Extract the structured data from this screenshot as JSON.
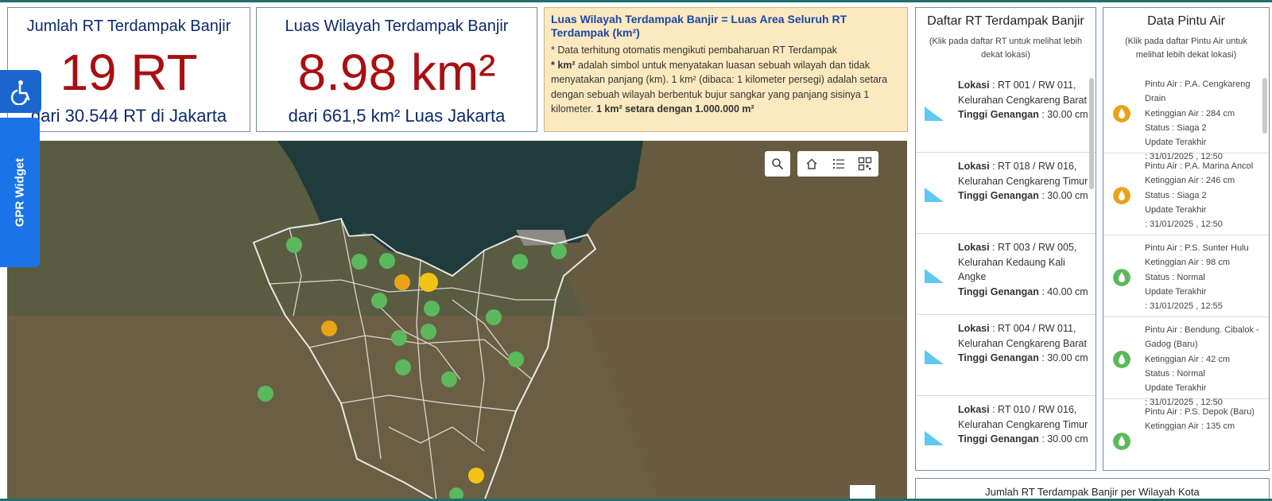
{
  "stat_rt": {
    "title": "Jumlah RT Terdampak Banjir",
    "value": "19 RT",
    "subtitle": "dari 30.544 RT di Jakarta"
  },
  "stat_luas": {
    "title": "Luas Wilayah Terdampak Banjir",
    "value": "8.98 km²",
    "subtitle": "dari 661,5 km² Luas Jakarta"
  },
  "info": {
    "title": "Luas Wilayah Terdampak Banjir = Luas Area Seluruh RT Terdampak (km²)",
    "line1": "* Data terhitung otomatis mengikuti pembaharuan RT Terdampak",
    "line2_bold": "* km²",
    "line2_rest": " adalah simbol untuk menyatakan luasan sebuah wilayah dan tidak menyatakan panjang (km). 1 km² (dibaca: 1 kilometer persegi) adalah setara dengan sebuah wilayah berbentuk bujur sangkar yang panjang sisinya 1 kilometer. ",
    "line2_tail_bold": "1 km² setara dengan 1.000.000 m²"
  },
  "rt_panel": {
    "title": "Daftar RT Terdampak Banjir",
    "note": "(Klik pada daftar RT untuk melihat lebih dekat lokasi)",
    "lokasi_label": "Lokasi",
    "tinggi_label": "Tinggi Genangan",
    "items": [
      {
        "lokasi": "RT 001 / RW 011, Kelurahan Cengkareng Barat",
        "tinggi": "30.00 cm"
      },
      {
        "lokasi": "RT 018 / RW 016, Kelurahan Cengkareng Timur",
        "tinggi": "30.00 cm"
      },
      {
        "lokasi": "RT 003 / RW 005, Kelurahan Kedaung Kali Angke",
        "tinggi": "40.00 cm"
      },
      {
        "lokasi": "RT 004 / RW 011, Kelurahan Cengkareng Barat",
        "tinggi": "30.00 cm"
      },
      {
        "lokasi": "RT 010 / RW 016, Kelurahan Cengkareng Timur",
        "tinggi": "30.00 cm"
      }
    ]
  },
  "pa_panel": {
    "title": "Data Pintu Air",
    "note": "(Klik pada daftar Pintu Air untuk melihat lebih dekat lokasi)",
    "items": [
      {
        "nama": "Pintu Air : P.A. Cengkareng Drain",
        "tinggi": "Ketinggian Air : 284 cm",
        "status": "Status : Siaga 2",
        "update": "Update Terakhir",
        "waktu": ": 31/01/2025 , 12:50",
        "color": "#e8a317"
      },
      {
        "nama": "Pintu Air : P.A. Marina Ancol",
        "tinggi": "Ketinggian Air : 246 cm",
        "status": "Status : Siaga 2",
        "update": "Update Terakhir",
        "waktu": ": 31/01/2025 , 12:50",
        "color": "#e8a317"
      },
      {
        "nama": "Pintu Air : P.S. Sunter Hulu",
        "tinggi": "Ketinggian Air : 98 cm",
        "status": "Status : Normal",
        "update": "Update Terakhir",
        "waktu": ": 31/01/2025 , 12:55",
        "color": "#5cb85c"
      },
      {
        "nama": "Pintu Air : Bendung. Cibalok - Gadog (Baru)",
        "tinggi": "Ketinggian Air : 42 cm",
        "status": "Status : Normal",
        "update": "Update Terakhir",
        "waktu": ": 31/01/2025 , 12:50",
        "color": "#5cb85c"
      },
      {
        "nama": "Pintu Air : P.S. Depok (Baru)",
        "tinggi": "Ketinggian Air : 135 cm",
        "status": "",
        "update": "",
        "waktu": "",
        "color": "#5cb85c"
      }
    ]
  },
  "bottom_card": {
    "title": "Jumlah RT Terdampak Banjir per Wilayah Kota"
  },
  "widget": {
    "label": "GPR Widget"
  },
  "icons": {
    "search": "search-icon",
    "home": "home-icon",
    "list": "list-icon",
    "qr": "qr-icon",
    "accessibility": "accessibility-icon",
    "water_gate": "water-drop-icon"
  },
  "colors": {
    "stat_value": "#a80f12",
    "stat_text": "#0e2a6b",
    "info_bg": "#fde9bf",
    "info_title": "#1a47a8",
    "status_normal": "#5cb85c",
    "status_siaga": "#e8a317",
    "status_waspada": "#f2c314",
    "flag": "#5ec8ef"
  }
}
